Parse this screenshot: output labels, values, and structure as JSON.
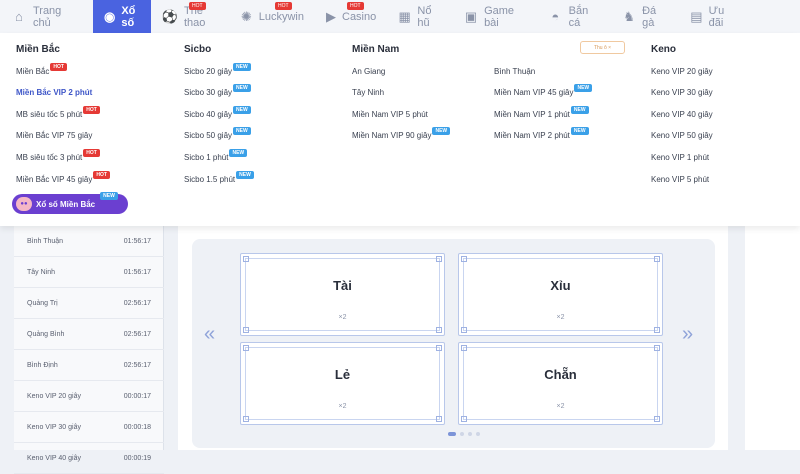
{
  "nav": [
    {
      "label": "Trang chủ",
      "icon": "home-icon",
      "active": false,
      "hot": false
    },
    {
      "label": "Xổ số",
      "icon": "lottery-ball-icon",
      "active": true,
      "hot": false
    },
    {
      "label": "Thể thao",
      "icon": "soccer-ball-icon",
      "active": false,
      "hot": true
    },
    {
      "label": "Luckywin",
      "icon": "luckywin-icon",
      "active": false,
      "hot": true
    },
    {
      "label": "Casino",
      "icon": "casino-icon",
      "active": false,
      "hot": true
    },
    {
      "label": "Nổ hũ",
      "icon": "slot-icon",
      "active": false,
      "hot": false
    },
    {
      "label": "Game bài",
      "icon": "gamepad-icon",
      "active": false,
      "hot": false
    },
    {
      "label": "Bắn cá",
      "icon": "fish-icon",
      "active": false,
      "hot": false
    },
    {
      "label": "Đá gà",
      "icon": "rooster-icon",
      "active": false,
      "hot": false
    },
    {
      "label": "Ưu đãi",
      "icon": "gift-icon",
      "active": false,
      "hot": false
    }
  ],
  "hot_label": "HOT",
  "new_label": "NEW",
  "dropdown": {
    "columns": [
      {
        "heading": "Miền Bắc",
        "items": [
          {
            "label": "Miền Bắc",
            "badge": "HOT"
          },
          {
            "label": "Miền Bắc VIP 2 phút",
            "badge": "",
            "highlight": true
          },
          {
            "label": "MB siêu tốc 5 phút",
            "badge": "HOT"
          },
          {
            "label": "Miền Bắc VIP 75 giây",
            "badge": ""
          },
          {
            "label": "MB siêu tốc 3 phút",
            "badge": "HOT"
          },
          {
            "label": "Miền Bắc VIP 45 giây",
            "badge": "HOT"
          }
        ]
      },
      {
        "heading": "Sicbo",
        "items": [
          {
            "label": "Sicbo 20 giây",
            "badge": "NEW"
          },
          {
            "label": "Sicbo 30 giây",
            "badge": "NEW"
          },
          {
            "label": "Sicbo 40 giây",
            "badge": "NEW"
          },
          {
            "label": "Sicbo 50 giây",
            "badge": "NEW"
          },
          {
            "label": "Sicbo 1 phút",
            "badge": "NEW"
          },
          {
            "label": "Sicbo 1.5 phút",
            "badge": "NEW"
          }
        ]
      },
      {
        "heading": "Miền Nam",
        "items": [
          {
            "label": "An Giang",
            "badge": ""
          },
          {
            "label": "Tây Ninh",
            "badge": ""
          },
          {
            "label": "Miền Nam VIP 5 phút",
            "badge": ""
          },
          {
            "label": "Miền Nam VIP 90 giây",
            "badge": "NEW"
          }
        ]
      },
      {
        "heading": "",
        "items": [
          {
            "label": "Bình Thuận",
            "badge": ""
          },
          {
            "label": "Miền Nam VIP 45 giây",
            "badge": "NEW"
          },
          {
            "label": "Miền Nam VIP 1 phút",
            "badge": "NEW"
          },
          {
            "label": "Miền Nam VIP 2 phút",
            "badge": "NEW"
          }
        ]
      },
      {
        "heading": "Keno",
        "items": [
          {
            "label": "Keno VIP 20 giây",
            "badge": ""
          },
          {
            "label": "Keno VIP 30 giây",
            "badge": ""
          },
          {
            "label": "Keno VIP 40 giây",
            "badge": ""
          },
          {
            "label": "Keno VIP 50 giây",
            "badge": ""
          },
          {
            "label": "Keno VIP 1 phút",
            "badge": ""
          },
          {
            "label": "Keno VIP 5 phút",
            "badge": ""
          }
        ]
      }
    ],
    "view_all": "Thu ô ×",
    "promo_chip": {
      "label": "Xổ số Miền Bắc",
      "badge": "NEW"
    }
  },
  "left_list": [
    {
      "name": "Bình Thuận",
      "time": "01:56:17"
    },
    {
      "name": "Tây Ninh",
      "time": "01:56:17"
    },
    {
      "name": "Quảng Trị",
      "time": "02:56:17"
    },
    {
      "name": "Quảng Bình",
      "time": "02:56:17"
    },
    {
      "name": "Bình Định",
      "time": "02:56:17"
    },
    {
      "name": "Keno VIP 20 giây",
      "time": "00:00:17"
    },
    {
      "name": "Keno VIP 30 giây",
      "time": "00:00:18"
    },
    {
      "name": "Keno VIP 40 giây",
      "time": "00:00:19"
    }
  ],
  "bets": [
    {
      "name": "Tài",
      "odds": "×2"
    },
    {
      "name": "Xỉu",
      "odds": "×2"
    },
    {
      "name": "Lẻ",
      "odds": "×2"
    },
    {
      "name": "Chẵn",
      "odds": "×2"
    }
  ],
  "pager": {
    "pages": 4,
    "current": 1
  },
  "colors": {
    "accent": "#4a63e0",
    "hot": "#e53935",
    "new": "#3aa0e8",
    "promo": "#6b3fd0"
  }
}
